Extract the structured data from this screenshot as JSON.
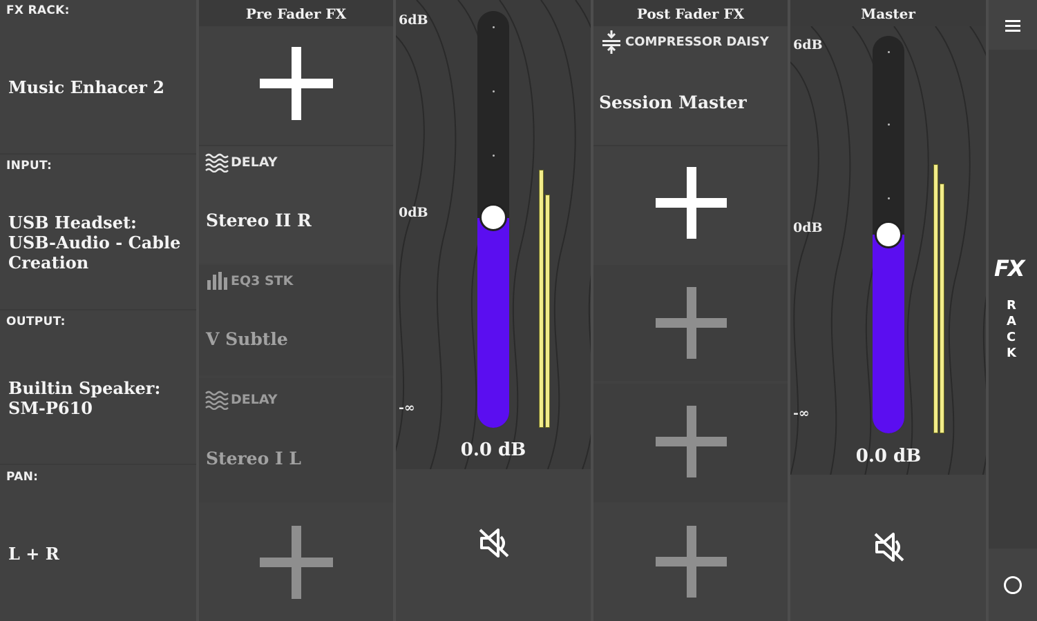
{
  "fx_rack": {
    "label": "FX RACK:",
    "name": "Music Enhacer 2",
    "input_label": "INPUT:",
    "input_value": "USB Headset: USB-Audio - Cable Creation",
    "output_label": "OUTPUT:",
    "output_value": "Builtin Speaker: SM-P610",
    "pan_label": "PAN:",
    "pan_value": "L + R"
  },
  "pre_fader": {
    "title": "Pre Fader FX",
    "slots": [
      {
        "fx": "DELAY",
        "preset": "Stereo II R",
        "icon": "waves-icon"
      },
      {
        "fx": "EQ3 STK",
        "preset": "V Subtle",
        "icon": "bars-icon"
      },
      {
        "fx": "DELAY",
        "preset": "Stereo I L",
        "icon": "waves-icon"
      }
    ]
  },
  "channel": {
    "top_db": "6dB",
    "zero_db": "0dB",
    "min_db": "-∞",
    "value": "0.0 dB",
    "level": 0.55,
    "meter_left": 0.7,
    "meter_right": 0.67
  },
  "post_fader": {
    "title": "Post Fader FX",
    "slots": [
      {
        "fx": "COMPRESSOR DAISY",
        "preset": "Session Master",
        "icon": "compress-icon"
      }
    ]
  },
  "master": {
    "title": "Master",
    "top_db": "6dB",
    "zero_db": "0dB",
    "min_db": "-∞",
    "value": "0.0 dB",
    "level": 0.5,
    "meter_left": 0.7,
    "meter_right": 0.65
  },
  "sidebar": {
    "menu_icon": "menu-icon",
    "logo": "FX",
    "rack_letters": [
      "R",
      "A",
      "C",
      "K"
    ],
    "home_icon": "circle-icon"
  },
  "colors": {
    "fader_fill": "#5b0ef0",
    "meter": "#f2ec8a",
    "background": "#414141"
  }
}
